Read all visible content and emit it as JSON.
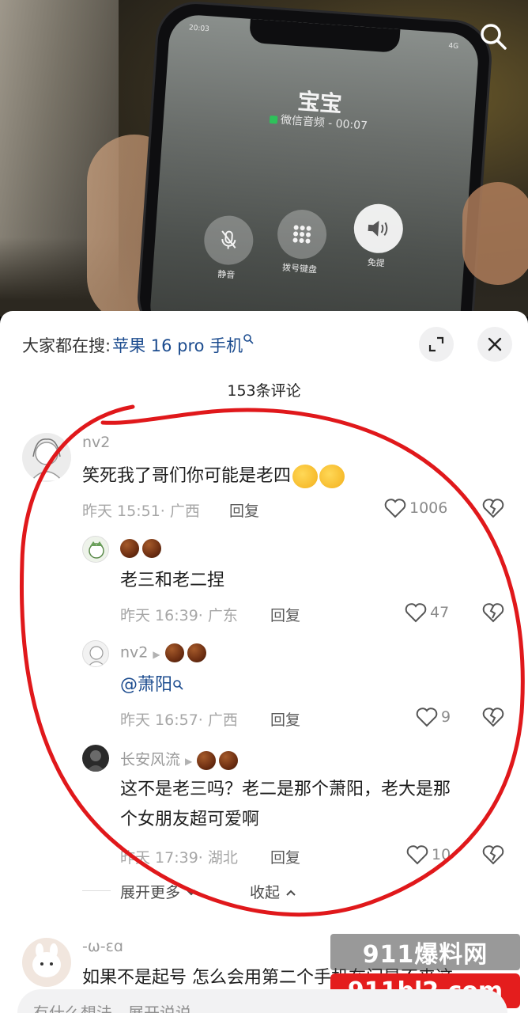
{
  "video": {
    "phone_time": "20:03",
    "phone_status": "4G",
    "caller_name": "宝宝",
    "call_duration": "微信音频 - 00:07",
    "controls": [
      {
        "label": "静音",
        "icon": "mic-off-icon"
      },
      {
        "label": "拨号键盘",
        "icon": "dialpad-icon"
      },
      {
        "label": "免提",
        "icon": "speaker-icon"
      }
    ]
  },
  "sheet": {
    "hot_search_prefix": "大家都在搜:",
    "hot_search_term": "苹果 16 pro 手机",
    "comment_count": "153条评论"
  },
  "comments": [
    {
      "name": "nv2",
      "text": "笑死我了哥们你可能是老四",
      "time": "昨天 15:51",
      "location": "广西",
      "reply": "回复",
      "likes": "1006"
    },
    {
      "name": "",
      "text": "老三和老二捏",
      "time": "昨天 16:39",
      "location": "广东",
      "reply": "回复",
      "likes": "47"
    },
    {
      "name": "nv2",
      "mention": "@萧阳",
      "time": "昨天 16:57",
      "location": "广西",
      "reply": "回复",
      "likes": "9"
    },
    {
      "name": "长安风流",
      "text_line1": "这不是老三吗？老二是那个萧阳，老大是那",
      "text_line2": "个女朋友超可爱啊",
      "time": "昨天 17:39",
      "location": "湖北",
      "reply": "回复",
      "likes": "10"
    },
    {
      "name": "-ω-ɛɑ",
      "text": "如果不是起号 怎么会用第二个手机在门是不来这"
    }
  ],
  "thread": {
    "more": "展开更多",
    "fold": "收起"
  },
  "input": {
    "placeholder": "有什么想法，展开说说"
  },
  "watermark": {
    "top": "911爆料网",
    "bottom": "911bl2.com"
  },
  "colors": {
    "link_blue": "#1c4c8f",
    "annotation_red": "#e0181b"
  }
}
